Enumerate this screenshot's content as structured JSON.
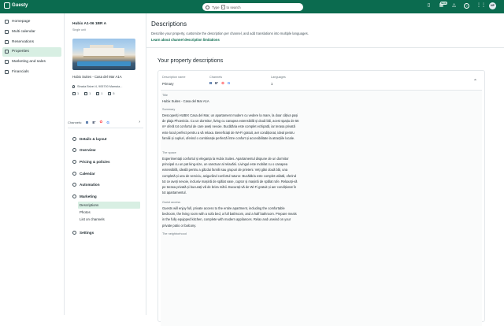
{
  "app": {
    "name": "Guesty"
  },
  "search": {
    "prefix": "Type",
    "key": "/",
    "suffix": "to search"
  },
  "topbar": {
    "new_badge": "NEW",
    "avatar_initials": "NP"
  },
  "nav": {
    "items": [
      {
        "label": "Homepage"
      },
      {
        "label": "Multi calendar"
      },
      {
        "label": "Reservations"
      },
      {
        "label": "Properties",
        "active": true
      },
      {
        "label": "Marketing and sales"
      },
      {
        "label": "Financials"
      }
    ]
  },
  "property": {
    "title": "Hubix A1-06 1BR A",
    "subtitle": "Single unit",
    "name": "Hubix Suites - Casa del Mar A1A",
    "address": "Strada Brizei 4, 905700 Mamaia...",
    "stats": {
      "beds": "1",
      "bedrooms": "1",
      "baths": "1",
      "guests": "5"
    },
    "channels_label": "Channels:",
    "channels": [
      "B",
      "E'",
      "✿",
      "G"
    ]
  },
  "subnav": {
    "items": [
      {
        "label": "Details & layout"
      },
      {
        "label": "Overview"
      },
      {
        "label": "Pricing & policies"
      },
      {
        "label": "Calendar"
      },
      {
        "label": "Automation"
      }
    ],
    "marketing": {
      "label": "Marketing",
      "children": [
        "Descriptions",
        "Photos",
        "List on channels"
      ]
    },
    "settings": {
      "label": "Settings"
    }
  },
  "main": {
    "title": "Descriptions",
    "description": "Describe your property, customize the description per channel, and add translations into multiple languages.",
    "link": "Learn about channel description limitations",
    "section_title": "Your property descriptions",
    "card": {
      "col_description": "Description name",
      "col_channels": "Channels",
      "col_languages": "Languages",
      "name_value": "Primary",
      "languages_value": "1",
      "channels": [
        "B",
        "E'",
        "✿",
        "G"
      ]
    },
    "fields": [
      {
        "label": "Title",
        "text": "Hubix Suites - Casa del Mar A1A"
      },
      {
        "label": "Summary",
        "text": "Descoperiți HUBIX Casa del Mar, un apartament modern cu vedere la mare, la doar câțiva pași de plaja Phoenicia. Cu un dormitor, living cu canapea extensibilă și două băi, acest spațiu de 56 m² oferă tot confortul de care aveți nevoie. Bucătăria este complet echipată, iar terasa privată este locul perfect pentru a vă relaxa. Beneficiați de Wi-Fi gratuit, aer condiționat, ideal pentru familii și cupluri, oferind o combinație perfectă între confort și accesibilitate la atracțiile locale."
      },
      {
        "label": "The space",
        "text": "Experimentați confortul și eleganța la Hubix Suites. Apartamentul dispune de un dormitor principal cu un pat king-size, un sanctuar al relaxării. Livingul este mobilat cu o canapea extensibilă, ideală pentru a găzdui familii sau grupuri de prieteni. Veți găsi două băi, una completă și una de serviciu, asigurând confortul tuturor. Bucătăria este complet utilată, oferind tot ce aveți nevoie, inclusiv mașină de spălat vase, cuptor și mașină de spălat rufe. Relaxați-vă pe terasa privată și bucurați-vă de briza mării. Bucurați-vă de Wi-Fi gratuit și aer condiționat în tot apartamentul."
      },
      {
        "label": "Guest access",
        "text": "Guests will enjoy full, private access to the entire apartment, including the comfortable bedroom, the living room with a sofa bed, a full bathroom, and a half bathroom. Prepare meals in the fully equipped kitchen, complete with modern appliances. Relax and unwind on your private patio or balcony."
      },
      {
        "label": "The neighborhood",
        "text": ""
      }
    ]
  }
}
